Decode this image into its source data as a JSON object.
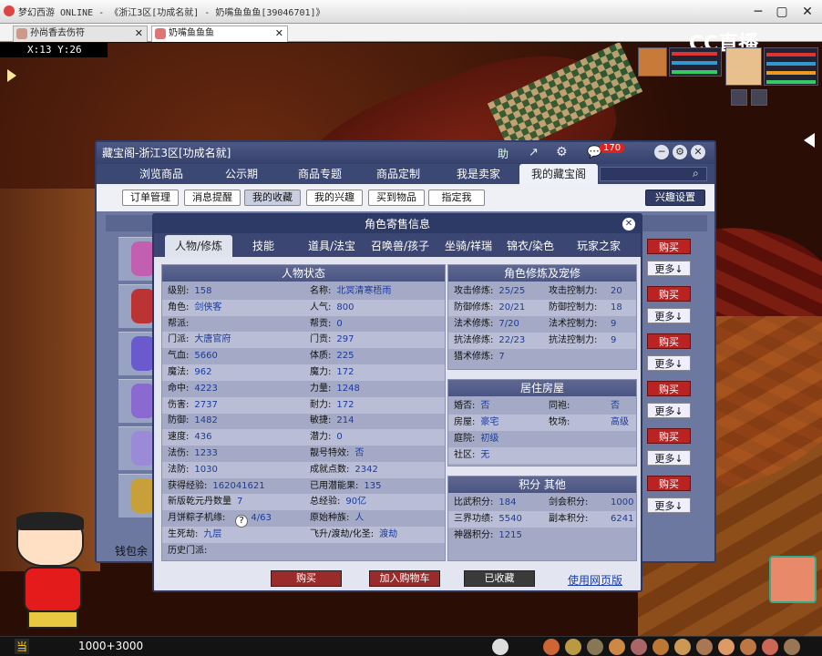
{
  "window": {
    "title": "梦幻西游 ONLINE - 《浙江3区[功成名就] - 奶嘴鱼鱼鱼[39046701]》"
  },
  "browser_tabs": [
    {
      "label": "孙尚香去伤符",
      "active": false
    },
    {
      "label": "奶嘴鱼鱼鱼",
      "active": true
    }
  ],
  "game": {
    "coords": "X:13 Y:26",
    "money": "1000+3000",
    "stream_logo": "CC直播",
    "left_hud_label": "当"
  },
  "market": {
    "title": "藏宝阁-浙江3区[功成名就]",
    "help": "助",
    "badge_count": "170",
    "nav": [
      "浏览商品",
      "公示期",
      "商品专题",
      "商品定制",
      "我是卖家",
      "我的藏宝阁"
    ],
    "nav_active": 5,
    "subnav": [
      "订单管理",
      "消息提醒",
      "我的收藏",
      "我的兴趣",
      "买到物品",
      "指定我"
    ],
    "subnav_active": 2,
    "interest_settings": "兴趣设置",
    "buy_label": "购买",
    "more_label": "更多↓",
    "wallet_label": "钱包余"
  },
  "detail": {
    "title": "角色寄售信息",
    "tabs": [
      "人物/修炼",
      "技能",
      "道具/法宝",
      "召唤兽/孩子",
      "坐骑/祥瑞",
      "锦衣/染色",
      "玩家之家"
    ],
    "tab_active": 0,
    "status_header": "人物状态",
    "status_left": [
      {
        "k": "级别:",
        "v": "158"
      },
      {
        "k": "角色:",
        "v": "剑侠客"
      },
      {
        "k": "帮派:",
        "v": ""
      },
      {
        "k": "门派:",
        "v": "大唐官府"
      },
      {
        "k": "气血:",
        "v": "5660"
      },
      {
        "k": "魔法:",
        "v": "962"
      },
      {
        "k": "命中:",
        "v": "4223"
      },
      {
        "k": "伤害:",
        "v": "2737"
      },
      {
        "k": "防御:",
        "v": "1482"
      },
      {
        "k": "速度:",
        "v": "436"
      },
      {
        "k": "法伤:",
        "v": "1233"
      },
      {
        "k": "法防:",
        "v": "1030"
      },
      {
        "k": "获得经验:",
        "v": "162041621"
      },
      {
        "k": "新版乾元丹数量",
        "v": "7"
      },
      {
        "k": "月饼粽子机缘:",
        "v": "4/63"
      },
      {
        "k": "生死劫:",
        "v": "九层"
      },
      {
        "k": "历史门派:",
        "v": ""
      }
    ],
    "status_right": [
      {
        "k": "名称:",
        "v": "北冥清寒梧雨"
      },
      {
        "k": "人气:",
        "v": "800"
      },
      {
        "k": "帮贡:",
        "v": "0"
      },
      {
        "k": "门贡:",
        "v": "297"
      },
      {
        "k": "体质:",
        "v": "225"
      },
      {
        "k": "魔力:",
        "v": "172"
      },
      {
        "k": "力量:",
        "v": "1248"
      },
      {
        "k": "耐力:",
        "v": "172"
      },
      {
        "k": "敏捷:",
        "v": "214"
      },
      {
        "k": "潜力:",
        "v": "0"
      },
      {
        "k": "靓号特效:",
        "v": "否"
      },
      {
        "k": "成就点数:",
        "v": "2342"
      },
      {
        "k": "已用潜能果:",
        "v": "135"
      },
      {
        "k": "总经验:",
        "v": "90亿"
      },
      {
        "k": "原始种族:",
        "v": "人"
      },
      {
        "k": "飞升/渡劫/化圣:",
        "v": "渡劫"
      }
    ],
    "cultivation_header": "角色修炼及宠修",
    "cultivation": [
      {
        "k": "攻击修炼:",
        "v": "25/25",
        "k2": "攻击控制力:",
        "v2": "20"
      },
      {
        "k": "防御修炼:",
        "v": "20/21",
        "k2": "防御控制力:",
        "v2": "18"
      },
      {
        "k": "法术修炼:",
        "v": "7/20",
        "k2": "法术控制力:",
        "v2": "9"
      },
      {
        "k": "抗法修炼:",
        "v": "22/23",
        "k2": "抗法控制力:",
        "v2": "9"
      },
      {
        "k": "猎术修炼:",
        "v": "7",
        "k2": "",
        "v2": ""
      }
    ],
    "house_header": "居住房屋",
    "house": [
      {
        "k": "婚否:",
        "v": "否",
        "k2": "同袍:",
        "v2": "否"
      },
      {
        "k": "房屋:",
        "v": "豪宅",
        "k2": "牧场:",
        "v2": "高级"
      },
      {
        "k": "庭院:",
        "v": "初级",
        "k2": "",
        "v2": ""
      },
      {
        "k": "社区:",
        "v": "无",
        "k2": "",
        "v2": ""
      }
    ],
    "points_header": "积分 其他",
    "points": [
      {
        "k": "比武积分:",
        "v": "184",
        "k2": "剑会积分:",
        "v2": "1000"
      },
      {
        "k": "三界功绩:",
        "v": "5540",
        "k2": "副本积分:",
        "v2": "6241"
      },
      {
        "k": "神器积分:",
        "v": "1215",
        "k2": "",
        "v2": ""
      }
    ],
    "buttons": {
      "buy": "购买",
      "add_cart": "加入购物车",
      "collected": "已收藏",
      "web": "使用网页版"
    },
    "help_icon": "?"
  }
}
